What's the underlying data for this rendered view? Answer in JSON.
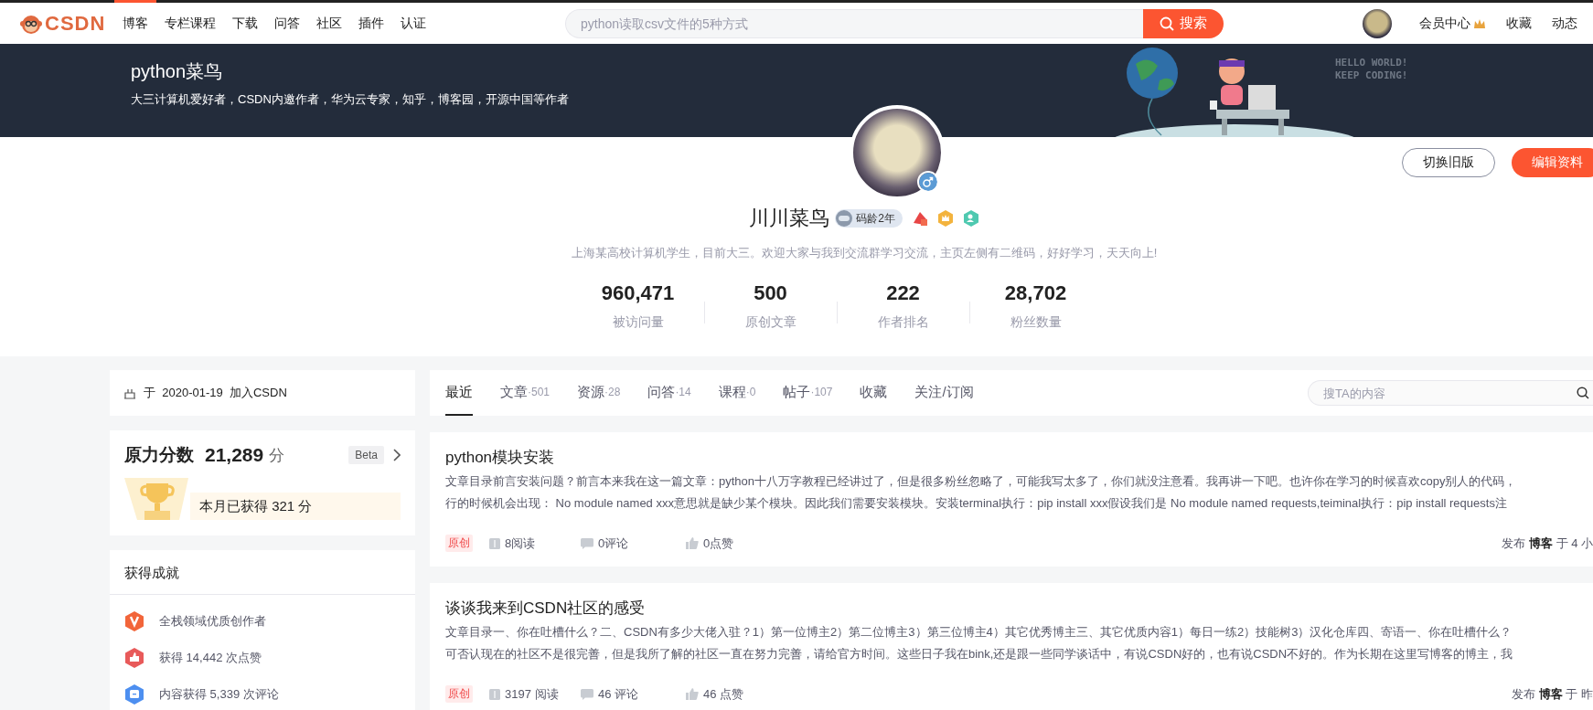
{
  "top_nav": {
    "logo": "CSDN",
    "items": [
      {
        "label": "博客",
        "selected": true
      },
      {
        "label": "专栏课程",
        "selected": false
      },
      {
        "label": "下载",
        "selected": false
      },
      {
        "label": "问答",
        "selected": false
      },
      {
        "label": "社区",
        "selected": false
      },
      {
        "label": "插件",
        "selected": false
      },
      {
        "label": "认证",
        "selected": false
      }
    ],
    "search": {
      "placeholder": "python读取csv文件的5种方式",
      "button": "搜索"
    },
    "right_links": [
      {
        "label": "会员中心",
        "kind": "vip"
      },
      {
        "label": "收藏",
        "kind": "plain"
      },
      {
        "label": "动态",
        "kind": "plain"
      }
    ]
  },
  "banner": {
    "title": "python菜鸟",
    "subtitle": "大三计算机爱好者，CSDN内邀作者，华为云专家，知乎，博客园，开源中国等作者",
    "art_text": [
      "HELLO WORLD!",
      "KEEP CODING!"
    ]
  },
  "profile": {
    "name": "川川菜鸟",
    "code_age": "码龄2年",
    "bio": "上海某高校计算机学生，目前大三。欢迎大家与我到交流群学习交流，主页左侧有二维码，好好学习，天天向上!",
    "buttons": [
      {
        "label": "切换旧版",
        "kind": "outline"
      },
      {
        "label": "编辑资料",
        "kind": "primary"
      }
    ],
    "stats": [
      {
        "value": "960,471",
        "label": "被访问量"
      },
      {
        "value": "500",
        "label": "原创文章"
      },
      {
        "value": "222",
        "label": "作者排名"
      },
      {
        "value": "28,702",
        "label": "粉丝数量"
      }
    ]
  },
  "sidebar": {
    "joined": "于  2020-01-19  加入CSDN",
    "power_score": {
      "title": "原力分数",
      "score": "21,289",
      "unit": "分",
      "badge": "Beta",
      "month": "本月已获得 321 分"
    },
    "achievements": {
      "title": "获得成就",
      "items": [
        {
          "kind": "creator",
          "text": "全栈领域优质创作者"
        },
        {
          "kind": "likes",
          "text": "获得 14,442 次点赞"
        },
        {
          "kind": "comments",
          "text": "内容获得 5,339 次评论"
        }
      ]
    }
  },
  "content": {
    "tabs": [
      {
        "label": "最近",
        "selected": true
      },
      {
        "label": "文章",
        "count": "·501",
        "selected": false
      },
      {
        "label": "资源",
        "count": "·28",
        "selected": false
      },
      {
        "label": "问答",
        "count": "·14",
        "selected": false
      },
      {
        "label": "课程",
        "count": "·0",
        "selected": false
      },
      {
        "label": "帖子",
        "count": "·107",
        "selected": false
      },
      {
        "label": "收藏",
        "selected": false
      },
      {
        "label": "关注/订阅",
        "selected": false
      }
    ],
    "search": {
      "placeholder": "搜TA的内容"
    },
    "articles": [
      {
        "title": "python模块安装",
        "excerpt": [
          "文章目录前言安装问题？前言本来我在这一篇文章：python十八万字教程已经讲过了，但是很多粉丝忽略了，可能我写太多了，你们就没注意看。我再讲一下吧。也许你在学习的时候喜欢copy别人的代码，",
          "行的时候机会出现：  No module named xxx意思就是缺少某个模块。因此我们需要安装模块。安装terminal执行：pip install xxx假设我们是 No module named requests,teiminal执行：pip install requests注"
        ],
        "tag": "原创",
        "reads": "8阅读",
        "comments": "0评论",
        "likes": "0点赞",
        "published": "发布 **博客** 于 4 小"
      },
      {
        "title": "谈谈我来到CSDN社区的感受",
        "excerpt": [
          "文章目录一、你在吐槽什么？二、CSDN有多少大佬入驻？1）第一位博主2）第二位博主3）第三位博主4）其它优秀博主三、其它优质内容1）每日一练2）技能树3）汉化仓库四、寄语一、你在吐槽什么？",
          "可否认现在的社区不是很完善，但是我所了解的社区一直在努力完善，请给官方时间。这些日子我在bink,还是跟一些同学谈话中，有说CSDN好的，也有说CSDN不好的。作为长期在这里写博客的博主，我"
        ],
        "tag": "原创",
        "reads": "3197 阅读",
        "comments": "46 评论",
        "likes": "46 点赞",
        "published": "发布 **博客** 于 昨"
      }
    ]
  }
}
